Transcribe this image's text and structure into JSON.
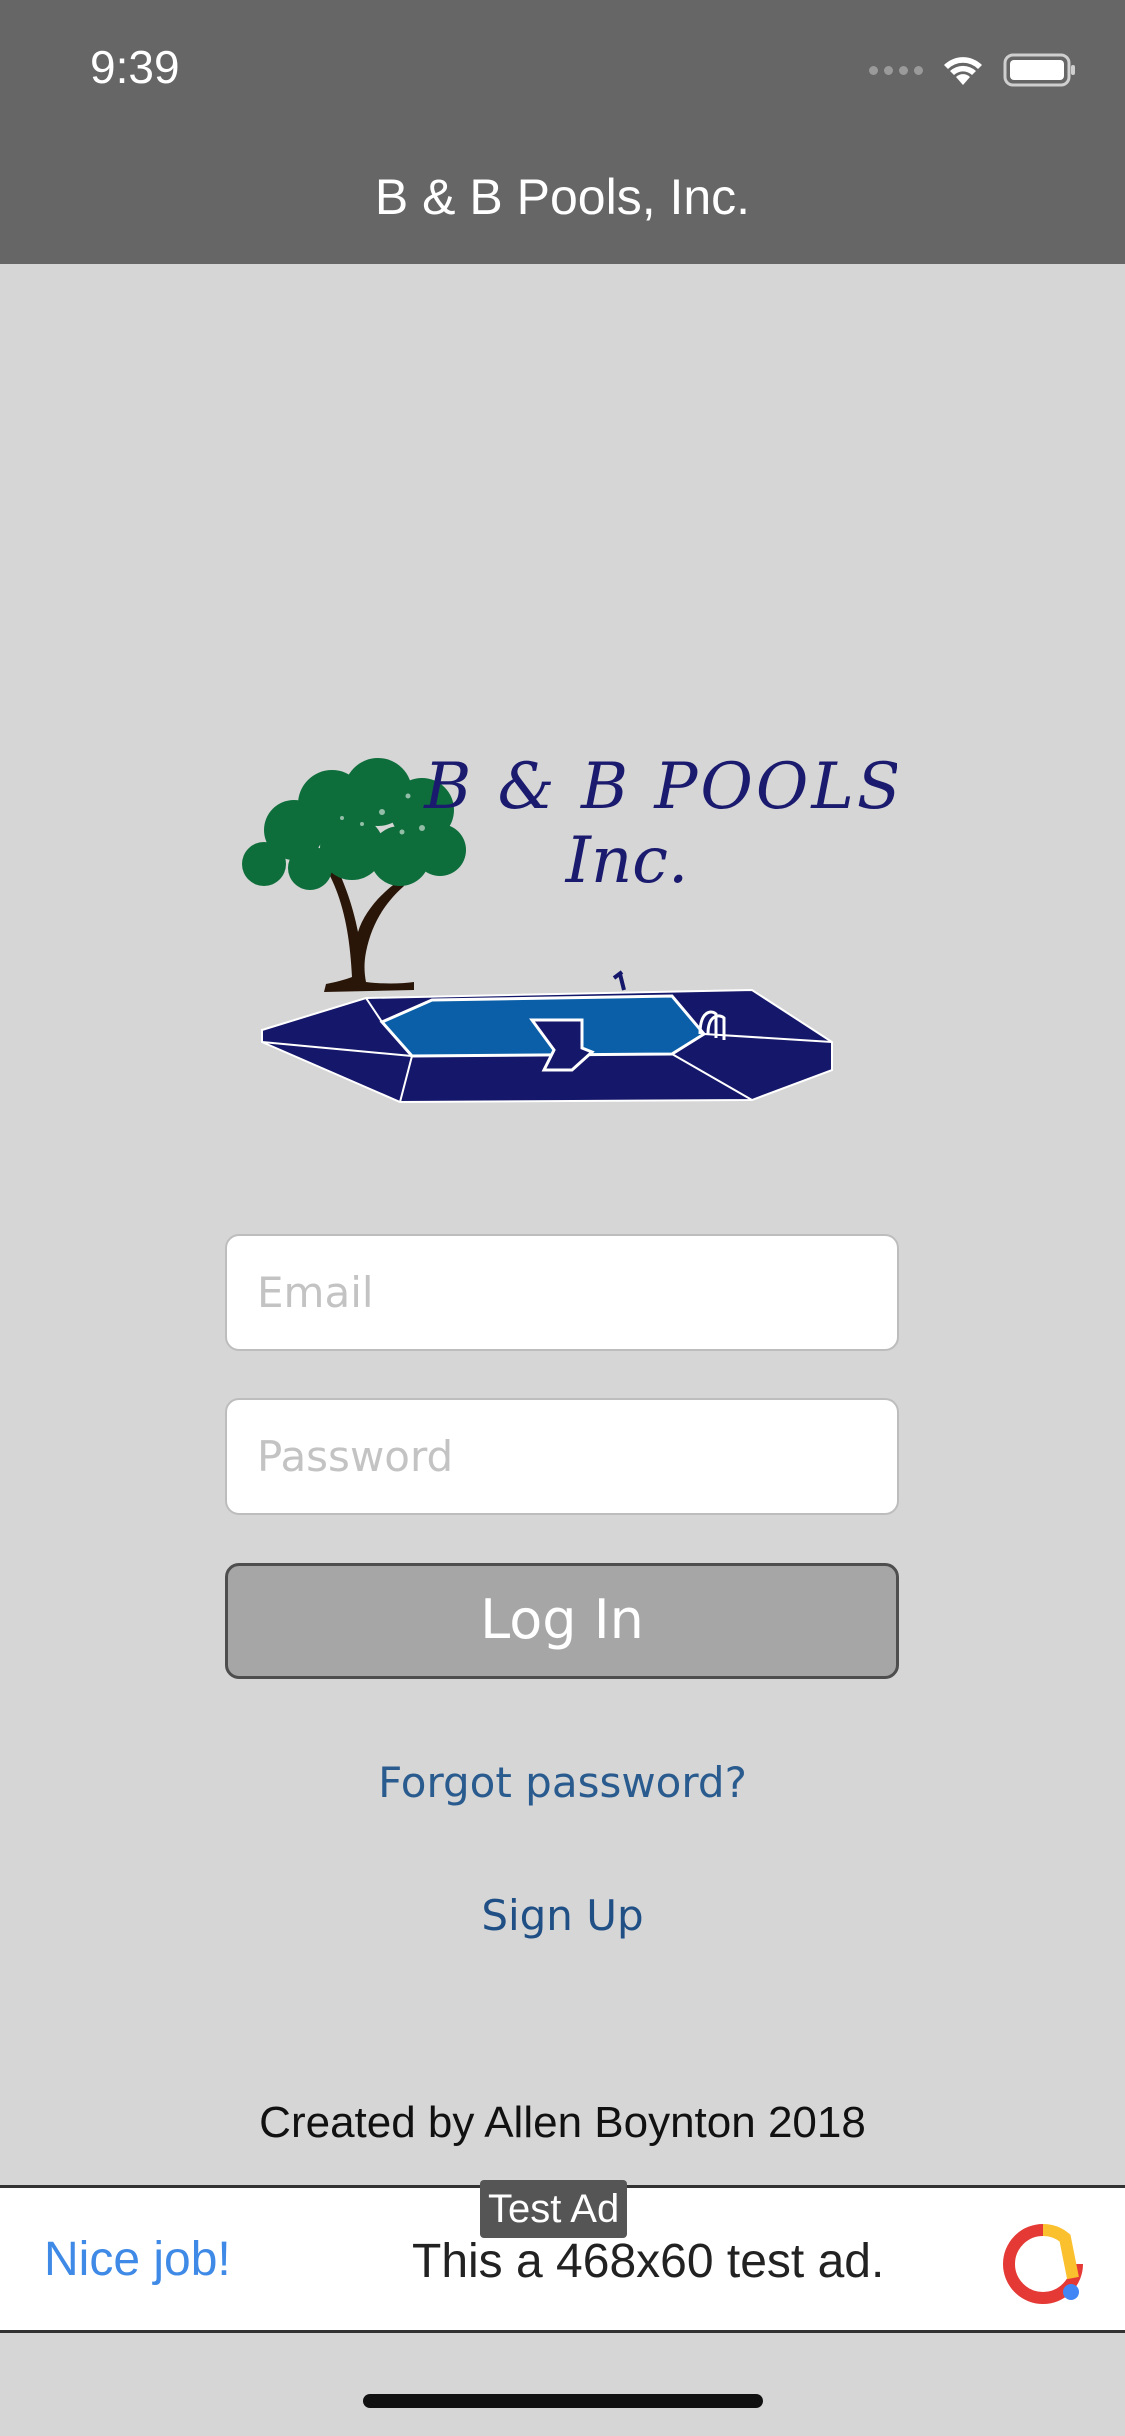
{
  "status_bar": {
    "time": "9:39"
  },
  "nav": {
    "title": "B & B Pools, Inc."
  },
  "logo": {
    "line1": "B & B POOLS",
    "line2": "Inc."
  },
  "form": {
    "email_placeholder": "Email",
    "email_value": "",
    "password_placeholder": "Password",
    "password_value": "",
    "login_label": "Log In",
    "forgot_label": "Forgot password?",
    "signup_label": "Sign Up"
  },
  "footer": {
    "credit": "Created by Allen Boynton 2018"
  },
  "ad": {
    "tag": "Test Ad",
    "headline": "Nice job!",
    "text": "This a 468x60 test ad."
  },
  "colors": {
    "nav_background": "#666666",
    "page_background": "#d6d6d6",
    "login_button": "#a6a6a6",
    "link": "#2a5b8f",
    "logo_navy": "#1a1a6e",
    "pool_blue": "#0b5fa8",
    "tree_green": "#0d6e3b"
  }
}
